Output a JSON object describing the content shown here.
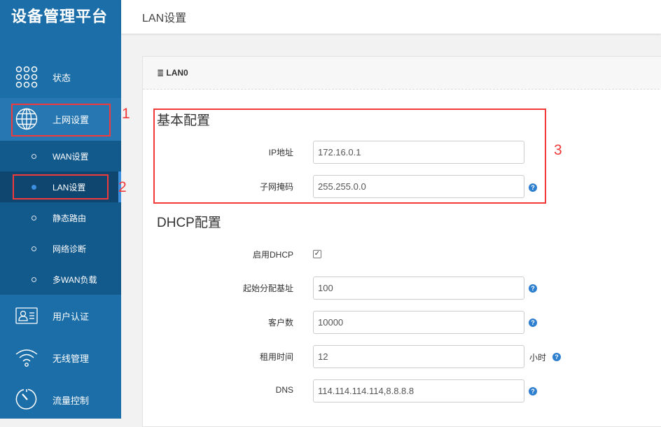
{
  "sidebar": {
    "brand": "设备管理平台",
    "items": [
      {
        "label": "状态",
        "icon": "grid-dots-icon"
      },
      {
        "label": "上网设置",
        "icon": "globe-icon"
      },
      {
        "label": "WAN设置"
      },
      {
        "label": "LAN设置"
      },
      {
        "label": "静态路由"
      },
      {
        "label": "网络诊断"
      },
      {
        "label": "多WAN负载"
      },
      {
        "label": "用户认证",
        "icon": "id-card-icon"
      },
      {
        "label": "无线管理",
        "icon": "wifi-icon"
      },
      {
        "label": "流量控制",
        "icon": "gauge-icon"
      }
    ]
  },
  "header": {
    "title": "LAN设置"
  },
  "panel": {
    "title": "LAN0",
    "basic": {
      "title": "基本配置",
      "ip_label": "IP地址",
      "ip": "172.16.0.1",
      "mask_label": "子网掩码",
      "mask": "255.255.0.0"
    },
    "dhcp": {
      "title": "DHCP配置",
      "enable_label": "启用DHCP",
      "enabled": true,
      "start_label": "起始分配基址",
      "start": "100",
      "clients_label": "客户数",
      "clients": "10000",
      "lease_label": "租用时间",
      "lease": "12",
      "lease_unit": "小时",
      "dns_label": "DNS",
      "dns": "114.114.114.114,8.8.8.8"
    }
  },
  "annotations": [
    "1",
    "2",
    "3"
  ],
  "colors": {
    "sidebar": "#1c6ea8",
    "accent": "#3d8fe0",
    "annotation": "#f23a3a"
  }
}
